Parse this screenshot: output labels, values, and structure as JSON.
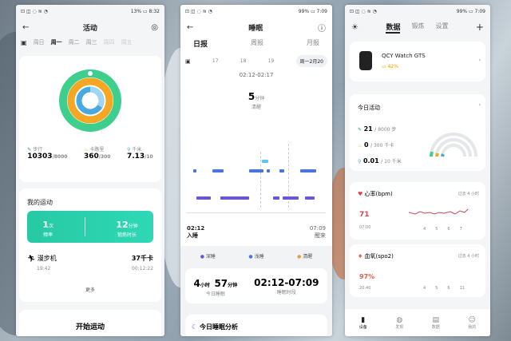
{
  "s1": {
    "status_left": "⊡ ◫ ◌ ≋ ◔",
    "status_right": "13% ▭ 8:32",
    "title": "活动",
    "tabs": [
      "周日",
      "周一",
      "周二",
      "周三",
      "周四",
      "周五",
      "周六"
    ],
    "stats": [
      {
        "label": "步行",
        "value": "10303",
        "unit": "/8000",
        "color": "#1aa06d"
      },
      {
        "label": "卡路里",
        "value": "360",
        "unit": "/300",
        "color": "#f5a623"
      },
      {
        "label": "千米",
        "value": "7.13",
        "unit": "/10",
        "color": "#3aa9d6"
      }
    ],
    "my_sport": "我的运动",
    "green": {
      "count": "1",
      "count_unit": "次",
      "count_label": "频率",
      "time": "12",
      "time_unit": "分钟",
      "time_label": "锻炼时长"
    },
    "walk": {
      "name": "漫步机",
      "time": "19:42",
      "kcal": "37千卡",
      "dur": "00:12:22"
    },
    "more": "更多",
    "start": "开始运动"
  },
  "s2": {
    "status_left": "⊡ ◫ ◌ ≋ ◔",
    "status_right": "99% ▭ 7:09",
    "title": "睡眠",
    "tabs": [
      "日报",
      "周报",
      "月报"
    ],
    "dates": [
      "17",
      "18",
      "19",
      "周一2月20"
    ],
    "range": "02:12-02:17",
    "big": "5",
    "big_unit": "分钟",
    "sub": "清醒",
    "start_time": "02:12",
    "start_label": "入睡",
    "end_time": "07:09",
    "end_label": "醒来",
    "legend": [
      {
        "label": "深睡",
        "color": "#6b54d6"
      },
      {
        "label": "浅睡",
        "color": "#4a74e0"
      },
      {
        "label": "清醒",
        "color": "#e8a040"
      }
    ],
    "total_h": "4",
    "h_unit": "小时",
    "total_m": "57",
    "m_unit": "分钟",
    "total_label": "今日睡眠",
    "span": "02:12-07:09",
    "span_label": "睡眠时段",
    "analysis": "今日睡眠分析"
  },
  "s3": {
    "status_left": "⊡ ◫ ◌ ≋ ◔",
    "status_right": "99% ▭ 7:09",
    "tabs": [
      "数据",
      "锻炼",
      "设置"
    ],
    "watch": "QCY Watch GTS",
    "battery": "42%",
    "today": "今日活动",
    "rows": [
      {
        "v": "21",
        "u": "/ 8000 步",
        "c": "#1aa06d"
      },
      {
        "v": "0",
        "u": "/ 300 千卡",
        "c": "#f5a623"
      },
      {
        "v": "0.01",
        "u": "/ 10 千米",
        "c": "#3aa9d6"
      }
    ],
    "hr": {
      "title": "心率(bpm)",
      "ago": "过去 4 小时",
      "value": "71",
      "t0": "07:00",
      "ticks": [
        "4",
        "5",
        "6",
        "7"
      ]
    },
    "spo": {
      "title": "血氧(spo2)",
      "ago": "过去 4 小时",
      "value": "97%",
      "t0": "20:40",
      "ticks": [
        "4",
        "5",
        "6",
        "11"
      ]
    },
    "nav": [
      "设备",
      "发现",
      "数据",
      "我的"
    ]
  }
}
